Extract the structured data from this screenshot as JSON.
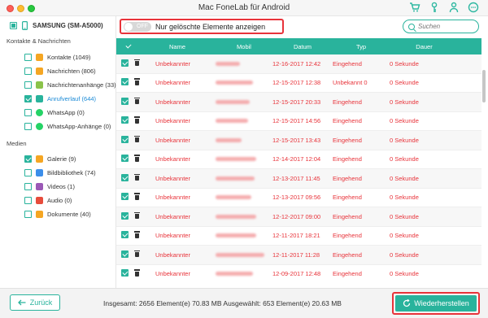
{
  "window": {
    "title": "Mac FoneLab für Android"
  },
  "title_icons": [
    "cart-icon",
    "key-icon",
    "person-icon",
    "chat-icon"
  ],
  "sidebar": {
    "device": "SAMSUNG (SM-A5000)",
    "sections": [
      {
        "title": "Kontakte & Nachrichten"
      },
      {
        "title": "Medien"
      }
    ],
    "items": [
      {
        "label": "Kontakte (1049)",
        "icon": "contacts-icon",
        "color": "#f5a623",
        "checked": false
      },
      {
        "label": "Nachrichten (806)",
        "icon": "messages-icon",
        "color": "#f5a623",
        "checked": false
      },
      {
        "label": "Nachrichtenanhänge (33)",
        "icon": "attachments-icon",
        "color": "#8bc34a",
        "checked": false
      },
      {
        "label": "Anrufverlauf (644)",
        "icon": "call-log-icon",
        "color": "#29b39c",
        "checked": true,
        "active": true
      },
      {
        "label": "WhatsApp (0)",
        "icon": "whatsapp-icon",
        "color": "#25d366",
        "checked": false
      },
      {
        "label": "WhatsApp-Anhänge (0)",
        "icon": "whatsapp-attachments-icon",
        "color": "#25d366",
        "checked": false
      },
      {
        "label": "Galerie (9)",
        "icon": "gallery-icon",
        "color": "#f5a623",
        "checked": true
      },
      {
        "label": "Bildbibliothek (74)",
        "icon": "picture-library-icon",
        "color": "#3b8eea",
        "checked": false
      },
      {
        "label": "Videos (1)",
        "icon": "videos-icon",
        "color": "#9b59b6",
        "checked": false
      },
      {
        "label": "Audio (0)",
        "icon": "audio-icon",
        "color": "#e74c3c",
        "checked": false
      },
      {
        "label": "Dokumente (40)",
        "icon": "documents-icon",
        "color": "#f5a623",
        "checked": false
      }
    ]
  },
  "toolbar": {
    "toggle_state": "OFF",
    "toggle_label": "Nur gelöschte Elemente anzeigen",
    "search_placeholder": "Suchen"
  },
  "table": {
    "columns": [
      "Name",
      "Mobil",
      "Datum",
      "Typ",
      "Dauer"
    ],
    "rows": [
      {
        "name": "Unbekannter",
        "date": "12-16-2017 12:42",
        "type": "Eingehend",
        "duration": "0 Sekunde"
      },
      {
        "name": "Unbekannter",
        "date": "12-15-2017 12:38",
        "type": "Unbekannt 0",
        "duration": "0 Sekunde"
      },
      {
        "name": "Unbekannter",
        "date": "12-15-2017 20:33",
        "type": "Eingehend",
        "duration": "0 Sekunde"
      },
      {
        "name": "Unbekannter",
        "date": "12-15-2017 14:56",
        "type": "Eingehend",
        "duration": "0 Sekunde"
      },
      {
        "name": "Unbekannter",
        "date": "12-15-2017 13:43",
        "type": "Eingehend",
        "duration": "0 Sekunde"
      },
      {
        "name": "Unbekannter",
        "date": "12-14-2017 12:04",
        "type": "Eingehend",
        "duration": "0 Sekunde"
      },
      {
        "name": "Unbekannter",
        "date": "12-13-2017 11:45",
        "type": "Eingehend",
        "duration": "0 Sekunde"
      },
      {
        "name": "Unbekannter",
        "date": "12-13-2017 09:56",
        "type": "Eingehend",
        "duration": "0 Sekunde"
      },
      {
        "name": "Unbekannter",
        "date": "12-12-2017 09:00",
        "type": "Eingehend",
        "duration": "0 Sekunde"
      },
      {
        "name": "Unbekannter",
        "date": "12-11-2017 18:21",
        "type": "Eingehend",
        "duration": "0 Sekunde"
      },
      {
        "name": "Unbekannter",
        "date": "12-11-2017 11:28",
        "type": "Eingehend",
        "duration": "0 Sekunde"
      },
      {
        "name": "Unbekannter",
        "date": "12-09-2017 12:48",
        "type": "Eingehend",
        "duration": "0 Sekunde"
      },
      {
        "name": "Unbekannter",
        "date": "12-09-2017 11:06",
        "type": "Eingehend",
        "duration": "0 Sekunde"
      }
    ]
  },
  "footer": {
    "back_label": "Zurück",
    "totals": "Insgesamt: 2656 Element(e) 70.83 MB   Ausgewählt: 653 Element(e) 20.63 MB",
    "restore_label": "Wiederherstellen"
  },
  "colors": {
    "accent": "#29b39c",
    "highlight": "#e8333a",
    "deleted_text": "#e8333a"
  }
}
